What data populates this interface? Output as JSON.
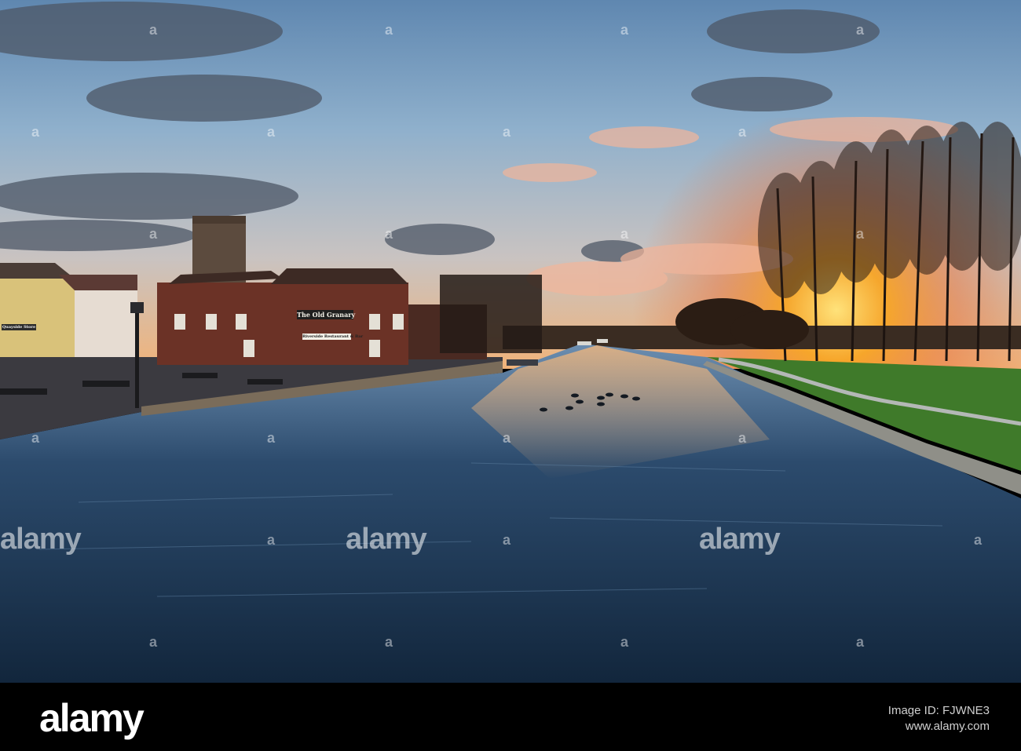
{
  "photo": {
    "scene": "river-quay-sunset",
    "colors": {
      "sky_top": "#6a8fb5",
      "sun_glow": "#f6a21a",
      "water": "#1f3550",
      "grass": "#3f7a2a",
      "brick": "#6b3226"
    }
  },
  "signs": {
    "main": "The Old Granary",
    "sub": "Riverside Restaurant & Bar",
    "shop": "Quayside Store"
  },
  "watermarks": {
    "label": "alamy",
    "positions_label": "a"
  },
  "footer": {
    "logo": "alamy",
    "image_id_label": "Image ID:",
    "image_id": "FJWNE3",
    "url": "www.alamy.com"
  }
}
